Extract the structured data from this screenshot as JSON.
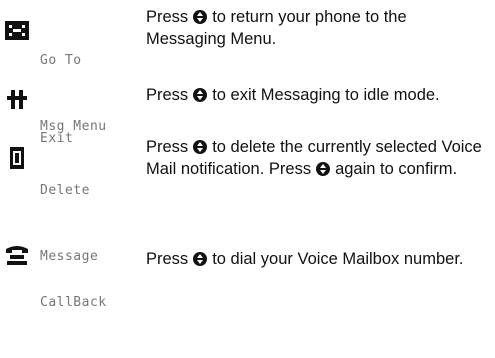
{
  "items": [
    {
      "icon": "messaging-menu-icon",
      "label_line1": "Go To",
      "label_line2": "Msg Menu",
      "text_a": "Press",
      "text_b": "to return your phone to the",
      "text_c": "Messaging Menu."
    },
    {
      "icon": "exit-icon",
      "label_line1": "Exit",
      "text_a": "Press",
      "text_b": "to exit Messaging to idle mode."
    },
    {
      "icon": "trash-can-icon",
      "label_line1": "Delete",
      "label_line2": "Message",
      "text_a": "Press",
      "text_b": "to delete the currently selected Voice",
      "text_c": "Mail notification. Press",
      "text_d": "again to confirm."
    },
    {
      "icon": "telephone-icon",
      "label_line1": "CallBack",
      "text_a": "Press",
      "text_b": "to dial your Voice Mailbox number."
    }
  ]
}
